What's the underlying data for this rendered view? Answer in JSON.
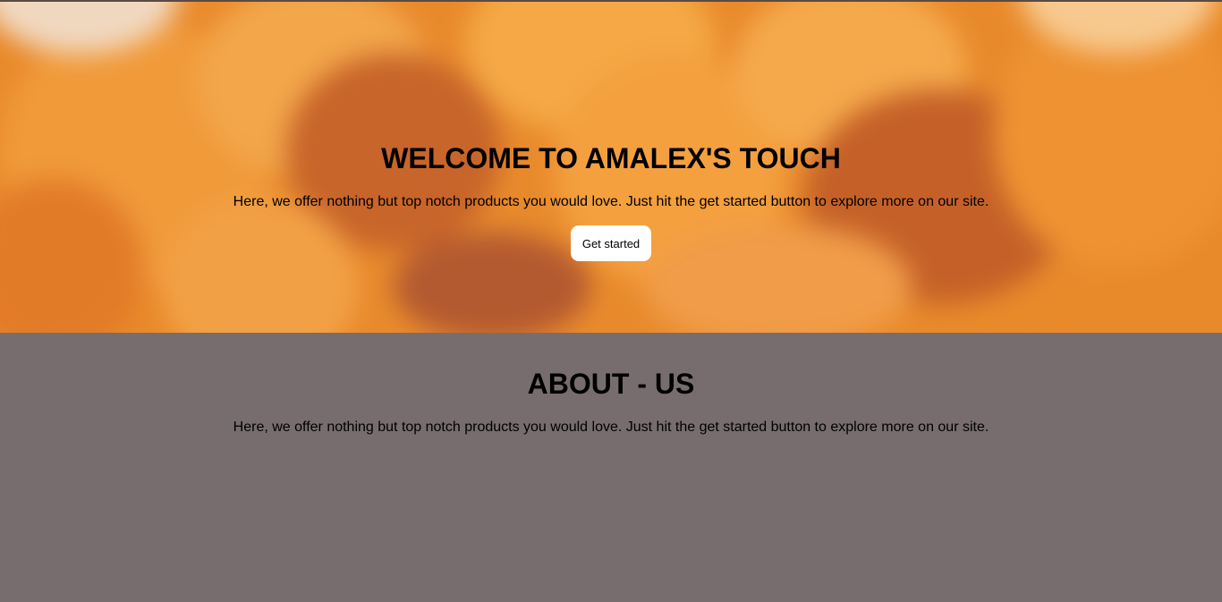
{
  "hero": {
    "title": "WELCOME TO AMALEX'S TOUCH",
    "text": "Here, we offer nothing but top notch products you would love. Just hit the get started button to explore more on our site.",
    "button_label": "Get started",
    "background_image": "blurred-oranges-photo"
  },
  "about": {
    "title": "ABOUT - US",
    "text": "Here, we offer nothing but top notch products you would love. Just hit the get started button to explore more on our site."
  },
  "colors": {
    "about_background": "#776d6e",
    "button_background": "#ffffff",
    "text": "#000000"
  }
}
